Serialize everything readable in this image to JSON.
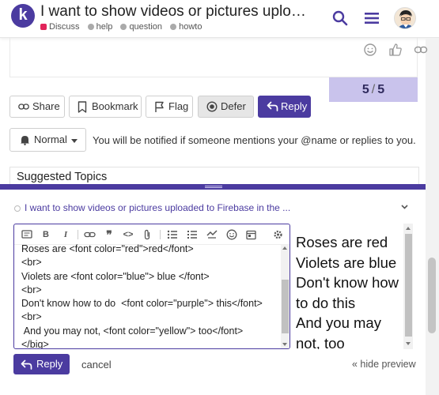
{
  "header": {
    "logo_letter": "k",
    "title": "I want to show videos or pictures uploaded to Firebase in the ...",
    "breadcrumbs": [
      {
        "label": "Discuss",
        "color": "#e1245a",
        "shape": "square"
      },
      {
        "label": "help",
        "color": "#aaaaaa",
        "shape": "round"
      },
      {
        "label": "question",
        "color": "#aaaaaa",
        "shape": "round"
      },
      {
        "label": "howto",
        "color": "#aaaaaa",
        "shape": "round"
      }
    ],
    "icons": [
      "search-icon",
      "hamburger-menu-icon",
      "user-avatar"
    ]
  },
  "post": {
    "action_icons": [
      "smile-icon",
      "like-icon",
      "link-icon"
    ],
    "progress": {
      "current": "5",
      "total": "5"
    }
  },
  "actions": {
    "share": "Share",
    "bookmark": "Bookmark",
    "flag": "Flag",
    "defer": "Defer",
    "reply": "Reply"
  },
  "notifications": {
    "level": "Normal",
    "text": "You will be notified if someone mentions your @name or replies to you."
  },
  "suggested": {
    "title": "Suggested Topics"
  },
  "composer": {
    "reply_to": "I want to show videos or pictures uploaded to Firebase in the ...",
    "toolbar": [
      "quote",
      "B",
      "I",
      "link",
      "blockquote",
      "code",
      "upload",
      "bullet-list",
      "numbered-list",
      "hide-details",
      "emoji",
      "date",
      "options"
    ],
    "editor_text": "Roses are <font color=\"red\">red</font>\n<br>\nViolets are <font color=\"blue\"> blue </font>\n<br>\nDon't know how to do  <font color=\"purple\"> this</font>\n<br>\n And you may not, <font color=\"yellow\"> too</font>\n</big>",
    "preview_lines": [
      "Roses are red",
      "Violets are blue",
      "Don't know how",
      "to do this",
      "And you may",
      "not, too"
    ],
    "submit_label": "Reply",
    "cancel_label": "cancel",
    "hide_preview_label": "« hide preview"
  },
  "colors": {
    "accent": "#4b3ba0",
    "progress_bg": "#c9c3ec",
    "discuss_category": "#e1245a"
  }
}
